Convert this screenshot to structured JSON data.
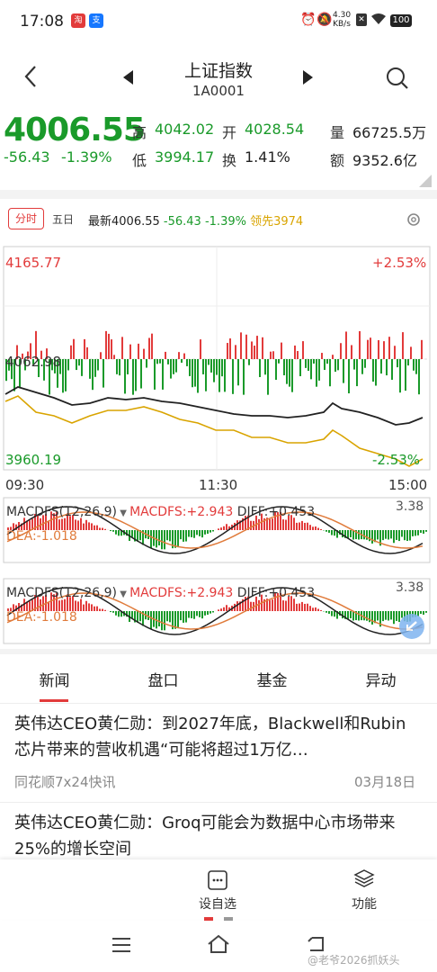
{
  "status": {
    "time": "17:08",
    "net_speed": "4.30",
    "net_unit": "KB/s",
    "battery": "100"
  },
  "header": {
    "title": "上证指数",
    "code": "1A0001"
  },
  "quote": {
    "price": "4006.55",
    "change": "-56.43",
    "change_pct": "-1.39%",
    "high_label": "高",
    "high": "4042.02",
    "open_label": "开",
    "open": "4028.54",
    "low_label": "低",
    "low": "3994.17",
    "turnover_label": "换",
    "turnover": "1.41%",
    "volume_label": "量",
    "volume": "66725.5万",
    "amount_label": "额",
    "amount": "9352.6亿"
  },
  "chart_tabs": {
    "active": "分时",
    "other": "五日",
    "latest_label": "最新4006.55",
    "latest_change": "-56.43",
    "latest_pct": "-1.39%",
    "lead_label": "领先3974"
  },
  "intraday": {
    "top_value": "4165.77",
    "top_pct": "+2.53%",
    "mid_value": "4062.98",
    "bottom_value": "3960.19",
    "bottom_pct": "-2.53%",
    "time_start": "09:30",
    "time_mid": "11:30",
    "time_end": "15:00"
  },
  "macd_panels": [
    {
      "name": "MACDFS(12,26,9)",
      "macd": "MACDFS:+2.943",
      "diff": "DIFF:+0.453",
      "dea": "DEA:-1.018",
      "top": "3.38"
    },
    {
      "name": "MACDFS(12,26,9)",
      "macd": "MACDFS:+2.943",
      "diff": "DIFF:+0.453",
      "dea": "DEA:-1.018",
      "top": "3.38"
    }
  ],
  "news_tabs": [
    "新闻",
    "盘口",
    "基金",
    "异动"
  ],
  "news": [
    {
      "title": "英伟达CEO黄仁勋：到2027年底，Blackwell和Rubin芯片带来的营收机遇“可能将超过1万亿…",
      "source": "同花顺7x24快讯",
      "date": "03月18日"
    },
    {
      "title": "英伟达CEO黄仁勋：Groq可能会为数据中心市场带来25%的增长空间",
      "source": "",
      "date": ""
    }
  ],
  "bottom_bar": {
    "watchlist_label": "设自选",
    "function_label": "功能"
  },
  "watermark": "@老爷2026抓妖头",
  "colors": {
    "up": "#e23b3b",
    "down": "#1a9a2a",
    "avg": "#d9a400",
    "price_line": "#222222"
  }
}
